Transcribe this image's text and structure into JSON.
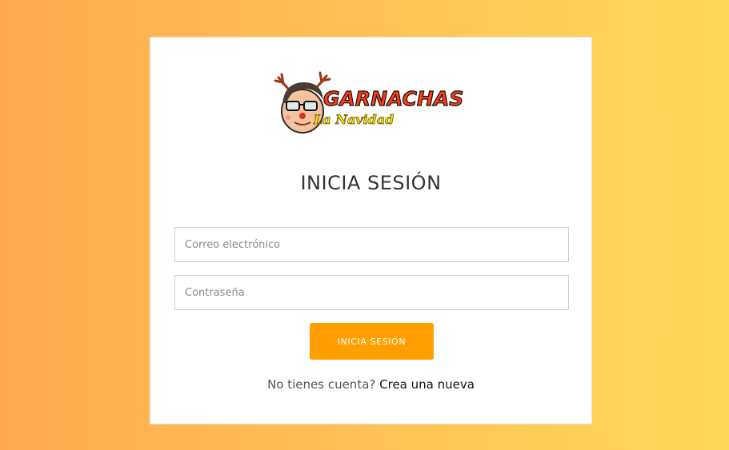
{
  "logo": {
    "brand_text": "GARNACHAS",
    "subtitle_text": "La Navidad",
    "colors": {
      "brand_red": "#ff3b12",
      "brand_yellow": "#ffe600",
      "antler": "#b5451b"
    }
  },
  "login": {
    "title": "INICIA SESIÓN",
    "email_placeholder": "Correo electrónico",
    "password_placeholder": "Contraseña",
    "submit_label": "INICIA SESIÓN",
    "signup_prompt": "No tienes cuenta?",
    "signup_link": "Crea una nueva"
  },
  "colors": {
    "background_left": "#ffaa4f",
    "background_right": "#ffd85a",
    "button": "#ffa000"
  }
}
